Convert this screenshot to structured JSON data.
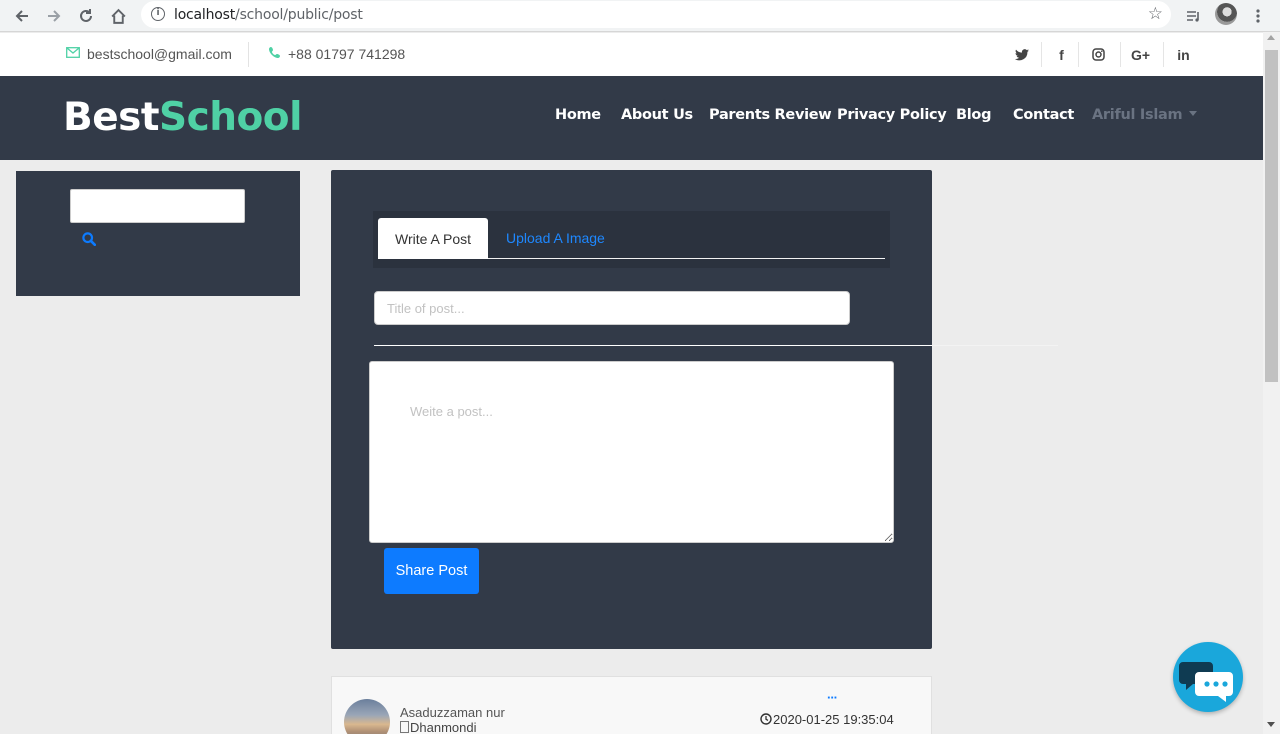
{
  "browser": {
    "url_host": "localhost",
    "url_path": "/school/public/post",
    "icons": [
      "back-icon",
      "forward-icon",
      "reload-icon",
      "home-icon",
      "info-icon",
      "star-icon",
      "media-icon",
      "menu-icon"
    ]
  },
  "topbar": {
    "email": "bestschool@gmail.com",
    "phone": "+88 01797 741298",
    "social_icons": [
      "twitter-icon",
      "facebook-icon",
      "instagram-icon",
      "google-plus-icon",
      "linkedin-icon"
    ],
    "social_glyphs": {
      "twitter": "𝕥",
      "facebook": "f",
      "instagram": "◎",
      "google_plus": "G+",
      "linkedin": "in"
    }
  },
  "header": {
    "logo_part1": "Best",
    "logo_part2": "School",
    "nav": {
      "home": "Home",
      "about": "About Us",
      "parents": "Parents Review",
      "privacy": "Privacy Policy",
      "blog": "Blog",
      "contact": "Contact"
    },
    "user": "Ariful Islam"
  },
  "composer": {
    "tab_write": "Write A Post",
    "tab_upload": "Upload A Image",
    "title_placeholder": "Title of post...",
    "post_placeholder": "Weite a post...",
    "share_label": "Share Post"
  },
  "post": {
    "author": "Asaduzzaman nur",
    "location": "Dhanmondi",
    "more": "···",
    "date": "2020-01-25 19:35:04"
  },
  "colors": {
    "accent_green": "#4fd1a5",
    "header_bg": "#323a48",
    "primary_blue": "#0d7bff",
    "chat_blue": "#1aa7db"
  }
}
